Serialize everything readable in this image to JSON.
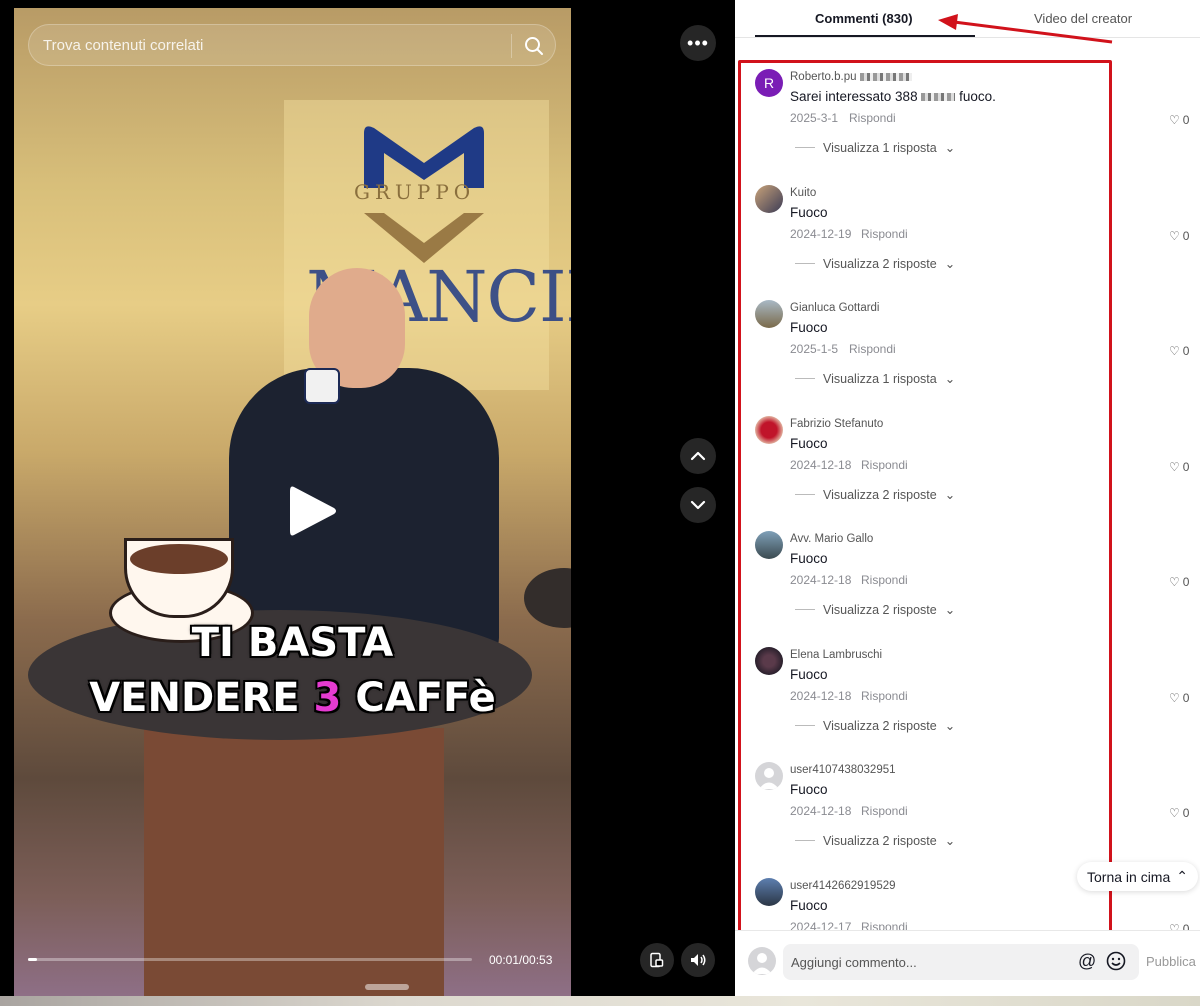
{
  "video": {
    "search_placeholder": "Trova contenuti correlati",
    "logo_word": "GRUPPO",
    "logo_brand": "MANCINI",
    "caption_line1": "TI BASTA",
    "caption_line2_a": "VENDERE",
    "caption_line2_num": "3",
    "caption_line2_b": "CAFFè",
    "time": "00:01/00:53",
    "progress_fraction": 0.02
  },
  "tabs": {
    "comments_label": "Commenti (830)",
    "creator_label": "Video del creator"
  },
  "comments": [
    {
      "user": "Roberto.b.pu",
      "text_a": "Sarei interessato 388",
      "text_b": "fuoco.",
      "date": "2025-3-1",
      "reply": "Rispondi",
      "likes": "0",
      "view": "Visualizza 1 risposta"
    },
    {
      "user": "Kuito",
      "text": "Fuoco",
      "date": "2024-12-19",
      "reply": "Rispondi",
      "likes": "0",
      "view": "Visualizza 2 risposte"
    },
    {
      "user": "Gianluca Gottardi",
      "text": "Fuoco",
      "date": "2025-1-5",
      "reply": "Rispondi",
      "likes": "0",
      "view": "Visualizza 1 risposta"
    },
    {
      "user": "Fabrizio Stefanuto",
      "text": "Fuoco",
      "date": "2024-12-18",
      "reply": "Rispondi",
      "likes": "0",
      "view": "Visualizza 2 risposte"
    },
    {
      "user": "Avv. Mario Gallo",
      "text": "Fuoco",
      "date": "2024-12-18",
      "reply": "Rispondi",
      "likes": "0",
      "view": "Visualizza 2 risposte"
    },
    {
      "user": "Elena Lambruschi",
      "text": "Fuoco",
      "date": "2024-12-18",
      "reply": "Rispondi",
      "likes": "0",
      "view": "Visualizza 2 risposte"
    },
    {
      "user": "user4107438032951",
      "text": "Fuoco",
      "date": "2024-12-18",
      "reply": "Rispondi",
      "likes": "0",
      "view": "Visualizza 2 risposte"
    },
    {
      "user": "user4142662919529",
      "text": "Fuoco",
      "date": "2024-12-17",
      "reply": "Rispondi",
      "likes": "0"
    }
  ],
  "first_avatar_letter": "R",
  "back_to_top": "Torna in cima",
  "input": {
    "placeholder": "Aggiungi commento...",
    "publish": "Pubblica"
  },
  "colors": {
    "annotation_red": "#d1121b",
    "avatar_purple": "#7a1db5",
    "caption_highlight": "#e53bd1"
  }
}
